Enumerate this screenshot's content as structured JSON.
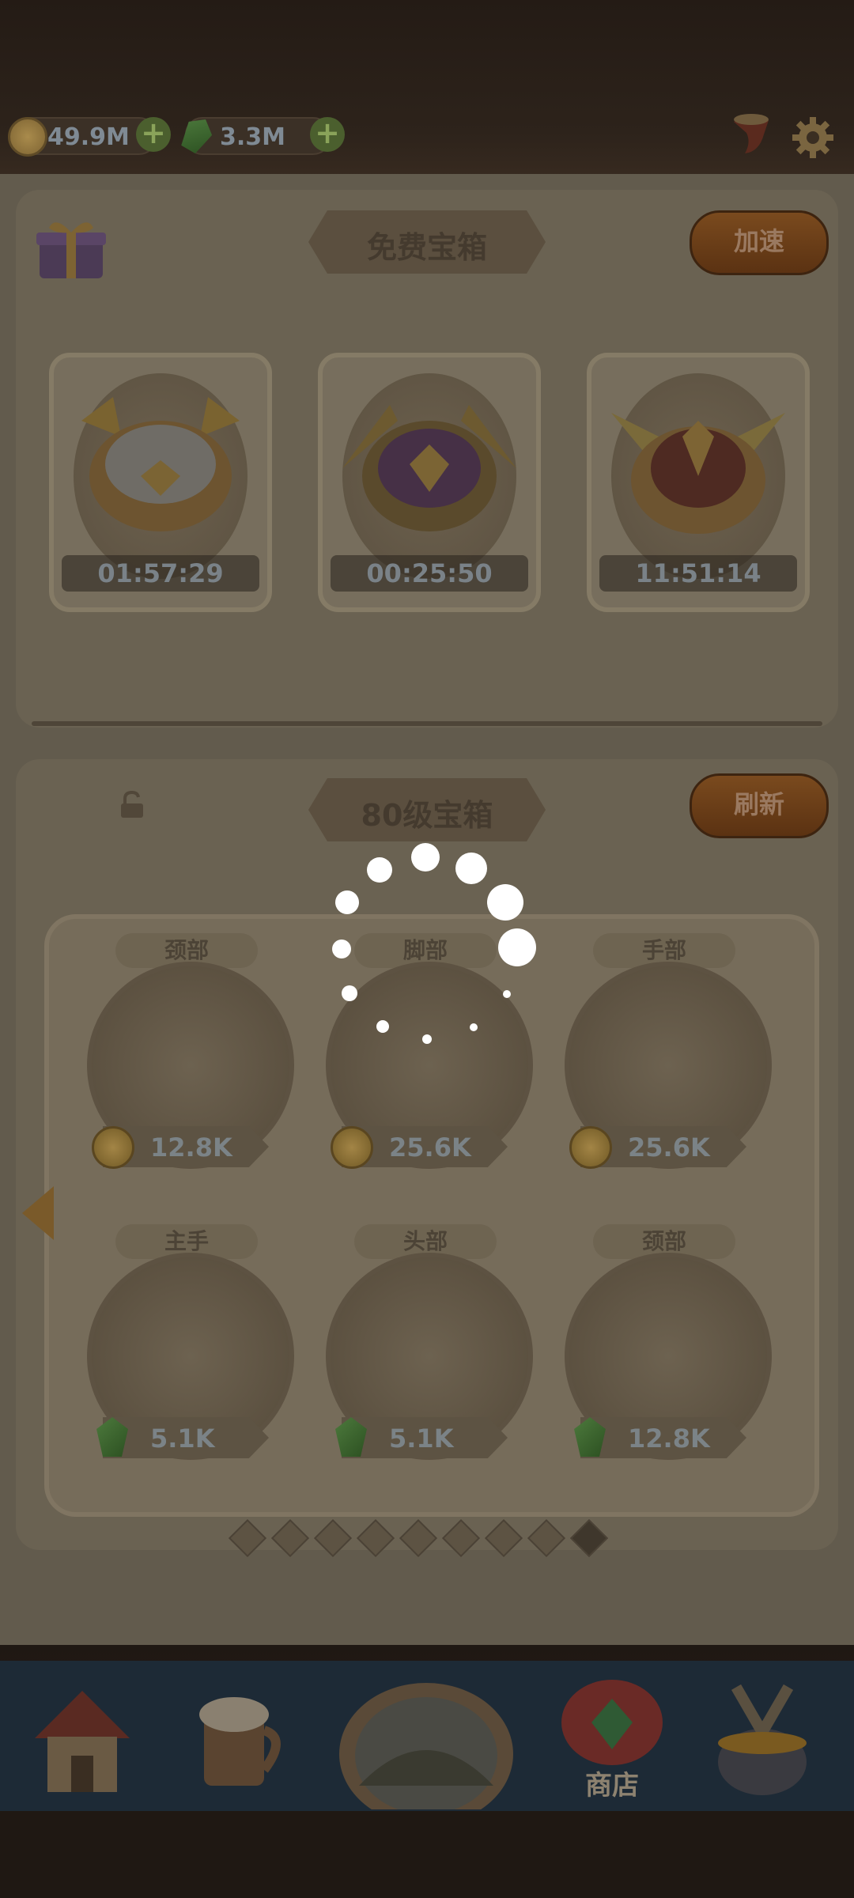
{
  "resources": {
    "gold": "49.9M",
    "gems": "3.3M"
  },
  "free_chests": {
    "title": "免费宝箱",
    "speed_button": "加速",
    "chests": [
      {
        "timer": "01:57:29",
        "icon": "silver-gold-chest-icon"
      },
      {
        "timer": "00:25:50",
        "icon": "purple-gold-chest-icon"
      },
      {
        "timer": "11:51:14",
        "icon": "red-gold-chest-icon"
      }
    ]
  },
  "level_chests": {
    "title": "80级宝箱",
    "refresh_button": "刷新",
    "items": [
      {
        "slot": "颈部",
        "price": "12.8K",
        "currency": "gold"
      },
      {
        "slot": "脚部",
        "price": "25.6K",
        "currency": "gold"
      },
      {
        "slot": "手部",
        "price": "25.6K",
        "currency": "gold"
      },
      {
        "slot": "主手",
        "price": "5.1K",
        "currency": "gem"
      },
      {
        "slot": "头部",
        "price": "5.1K",
        "currency": "gem"
      },
      {
        "slot": "颈部",
        "price": "12.8K",
        "currency": "gem"
      }
    ],
    "pages": 9,
    "active_page": 9
  },
  "bottom_nav": {
    "items": [
      {
        "icon": "house-icon",
        "label": ""
      },
      {
        "icon": "tavern-mug-icon",
        "label": ""
      },
      {
        "icon": "adventure-portal-icon",
        "label": ""
      },
      {
        "icon": "shop-icon",
        "label": "商店"
      },
      {
        "icon": "forge-icon",
        "label": ""
      }
    ],
    "active": "商店"
  }
}
